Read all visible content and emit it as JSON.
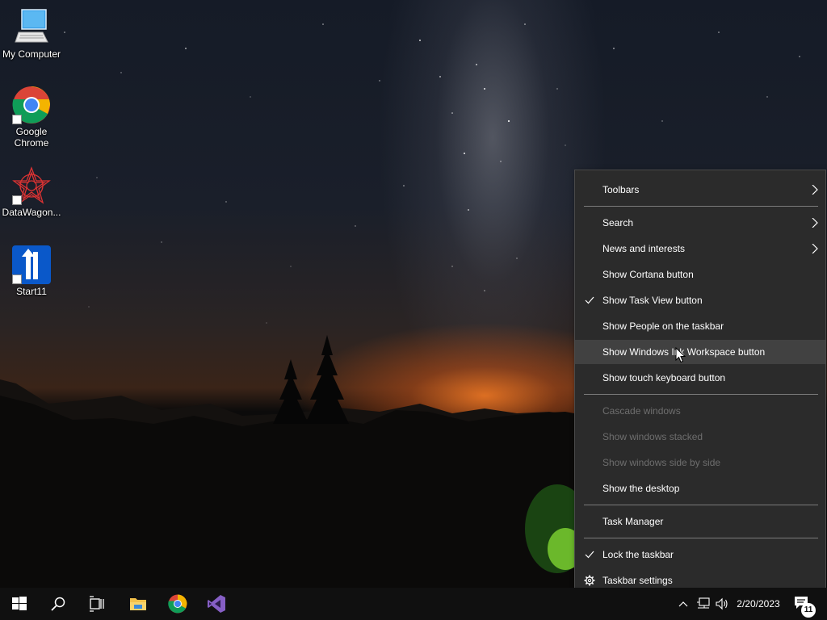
{
  "desktop": {
    "icons": [
      {
        "label": "My Computer"
      },
      {
        "label": "Google Chrome"
      },
      {
        "label": "DataWagon..."
      },
      {
        "label": "Start11"
      }
    ]
  },
  "context_menu": {
    "items": [
      {
        "label": "Toolbars",
        "submenu": true
      },
      {
        "label": "Search",
        "submenu": true
      },
      {
        "label": "News and interests",
        "submenu": true
      },
      {
        "label": "Show Cortana button"
      },
      {
        "label": "Show Task View button",
        "checked": true
      },
      {
        "label": "Show People on the taskbar"
      },
      {
        "label": "Show Windows Ink Workspace button",
        "highlighted": true
      },
      {
        "label": "Show touch keyboard button"
      },
      {
        "label": "Cascade windows",
        "disabled": true
      },
      {
        "label": "Show windows stacked",
        "disabled": true
      },
      {
        "label": "Show windows side by side",
        "disabled": true
      },
      {
        "label": "Show the desktop"
      },
      {
        "label": "Task Manager"
      },
      {
        "label": "Lock the taskbar",
        "checked": true
      },
      {
        "label": "Taskbar settings",
        "icon": "gear-icon"
      }
    ]
  },
  "taskbar": {
    "pinned": [
      "start-icon",
      "search-icon",
      "task-view-icon",
      "file-explorer-icon",
      "chrome-icon",
      "visual-studio-icon"
    ],
    "tray": {
      "date": "2/20/2023",
      "notification_count": "11"
    }
  },
  "colors": {
    "menu_bg": "#2b2b2b",
    "menu_hover": "#414141",
    "taskbar_bg": "#101010",
    "disabled_text": "#6e6e6e"
  }
}
